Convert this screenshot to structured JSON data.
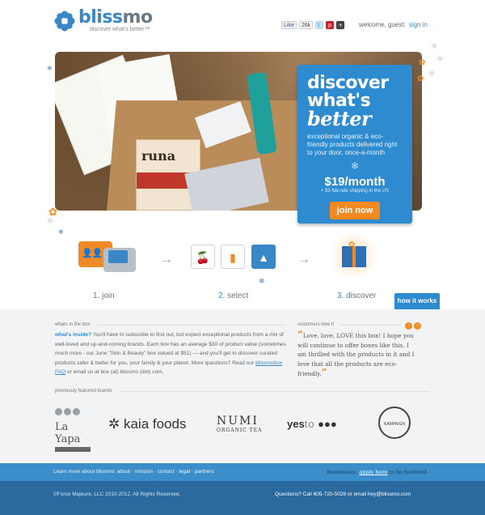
{
  "header": {
    "logo_name_a": "bliss",
    "logo_name_b": "mo",
    "tagline": "discover what's better™",
    "social": {
      "like": "Like",
      "like_count": "26k"
    },
    "welcome": "welcome, guest:",
    "signin": "sign in"
  },
  "hero": {
    "headline_1": "discover",
    "headline_2": "what's",
    "headline_3": "better",
    "description": "exceptional organic & eco-friendly products delivered right to your door, once-a-month",
    "price": "$19/month",
    "shipping": "+ $3 flat-rate shipping in the US",
    "join_label": "join now",
    "product_brand": "runa"
  },
  "steps": [
    {
      "num": "1.",
      "label": "join"
    },
    {
      "num": "2.",
      "label": "select"
    },
    {
      "num": "3.",
      "label": "discover"
    }
  ],
  "how_it_works": "how it works",
  "in_the_box": {
    "section_label": "whats in the box",
    "lead": "what's inside?",
    "body": " You'll have to subscribe to find out, but expect exceptional products from a mix of well-loved and up-and-coming brands. Each box has an average $30 of product value (sometimes much more - our June \"Skin & Beauty\" box valued at $51) — and you'll get to discover curated products safer & better for you, your family & your planet. More questions? Read our ",
    "faq_link": "blissmobox FAQ",
    "tail": " or email us at box (at) blissmo (dot) com."
  },
  "customers": {
    "section_label": "customers love it",
    "quote": "Love, love, LOVE this box! I hope you will continue to offer boxes like this. I am thrilled with the products in it and I love that all the products are eco-friendly."
  },
  "brands": {
    "section_label": "previously featured brands",
    "items": [
      "La Yapa",
      "kaia foods",
      "NUMI",
      "ORGANIC TEA",
      "yes",
      "to",
      "KAMPAIGN"
    ]
  },
  "footer": {
    "learn": "Learn more about blissmo: about · mission · contact · legal · partners",
    "biz_prefix": "Businesses, ",
    "biz_link": "apply here",
    "biz_suffix": " to be featured",
    "copyright": "©Force Majeure, LLC 2010-2012. All Rights Reserved.",
    "contact": "Questions? Call 605-720-5029 or email hey@blissmo.com"
  },
  "colors": {
    "brand_blue": "#2e8bd0",
    "accent_orange": "#f4891f",
    "footer_dark": "#2a6a9e"
  }
}
